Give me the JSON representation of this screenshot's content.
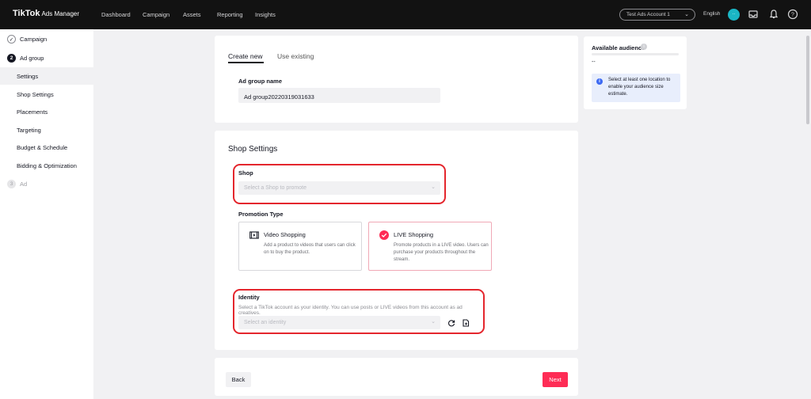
{
  "brand": {
    "logo": "TikTok",
    "sub": "Ads Manager"
  },
  "nav": [
    "Dashboard",
    "Campaign",
    "Assets",
    "Reporting",
    "Insights"
  ],
  "account": {
    "name": "Test Ads Account 1",
    "language": "English",
    "avatar_initial": "··"
  },
  "sidebar": {
    "steps": [
      {
        "num": "✓",
        "label": "Campaign",
        "state": "done"
      },
      {
        "num": "2",
        "label": "Ad group",
        "state": "current"
      },
      {
        "num": "3",
        "label": "Ad",
        "state": "todo"
      }
    ],
    "items": [
      "Settings",
      "Shop Settings",
      "Placements",
      "Targeting",
      "Budget & Schedule",
      "Bidding & Optimization"
    ]
  },
  "tabs": {
    "create": "Create new",
    "existing": "Use existing"
  },
  "adgroup": {
    "name_label": "Ad group name",
    "name_value": "Ad group20220319031633"
  },
  "shop_settings": {
    "title": "Shop Settings",
    "shop_label": "Shop",
    "shop_placeholder": "Select a Shop to promote",
    "promotion_label": "Promotion Type",
    "options": [
      {
        "title": "Video Shopping",
        "desc": "Add a product to videos that users can click on to buy the product."
      },
      {
        "title": "LIVE Shopping",
        "desc": "Promote products in a LIVE video. Users can purchase your products throughout the stream."
      }
    ],
    "identity_label": "Identity",
    "identity_hint": "Select a TikTok account as your identity. You can use posts or LIVE videos from this account as ad creatives.",
    "identity_placeholder": "Select an identity"
  },
  "buttons": {
    "back": "Back",
    "next": "Next"
  },
  "audience": {
    "title": "Available audience",
    "value": "--",
    "note": "Select at least one location to enable your audience size estimate."
  },
  "colors": {
    "accent": "#fe2c55",
    "highlight": "#e4262d",
    "info": "#3d6af2"
  }
}
